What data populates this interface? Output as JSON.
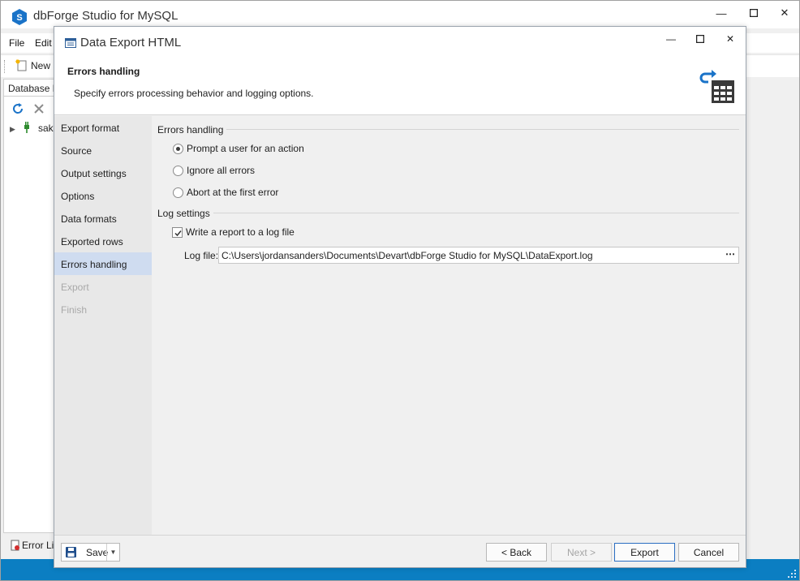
{
  "app": {
    "title": "dbForge Studio for MySQL",
    "menu": [
      "File",
      "Edit"
    ],
    "toolbar": {
      "new_label": "New S"
    },
    "db_explorer": {
      "tab_label": "Database Ex",
      "tree_item": "sakil"
    },
    "bottom_dock": {
      "error_list_label": "Error Lis"
    },
    "colors": {
      "statusbar": "#0b7ec2",
      "accent": "#2b6ec2"
    }
  },
  "dialog": {
    "title": "Data Export HTML",
    "header": {
      "title": "Errors handling",
      "description": "Specify errors processing behavior and logging options."
    },
    "nav": [
      {
        "label": "Export format",
        "state": "normal"
      },
      {
        "label": "Source",
        "state": "normal"
      },
      {
        "label": "Output settings",
        "state": "normal"
      },
      {
        "label": "Options",
        "state": "normal"
      },
      {
        "label": "Data formats",
        "state": "normal"
      },
      {
        "label": "Exported rows",
        "state": "normal"
      },
      {
        "label": "Errors handling",
        "state": "active"
      },
      {
        "label": "Export",
        "state": "disabled"
      },
      {
        "label": "Finish",
        "state": "disabled"
      }
    ],
    "errors_group": {
      "title": "Errors handling",
      "options": [
        {
          "label": "Prompt a user for an action",
          "selected": true
        },
        {
          "label": "Ignore all errors",
          "selected": false
        },
        {
          "label": "Abort at the first error",
          "selected": false
        }
      ]
    },
    "log_group": {
      "title": "Log settings",
      "write_report_label": "Write a report to a log file",
      "write_report_checked": true,
      "log_file_label": "Log file:",
      "log_file_value": "C:\\Users\\jordansanders\\Documents\\Devart\\dbForge Studio for MySQL\\DataExport.log",
      "browse_label": "⋯"
    },
    "footer": {
      "save_label": "Save",
      "back_label": "< Back",
      "next_label": "Next >",
      "export_label": "Export",
      "cancel_label": "Cancel"
    }
  }
}
